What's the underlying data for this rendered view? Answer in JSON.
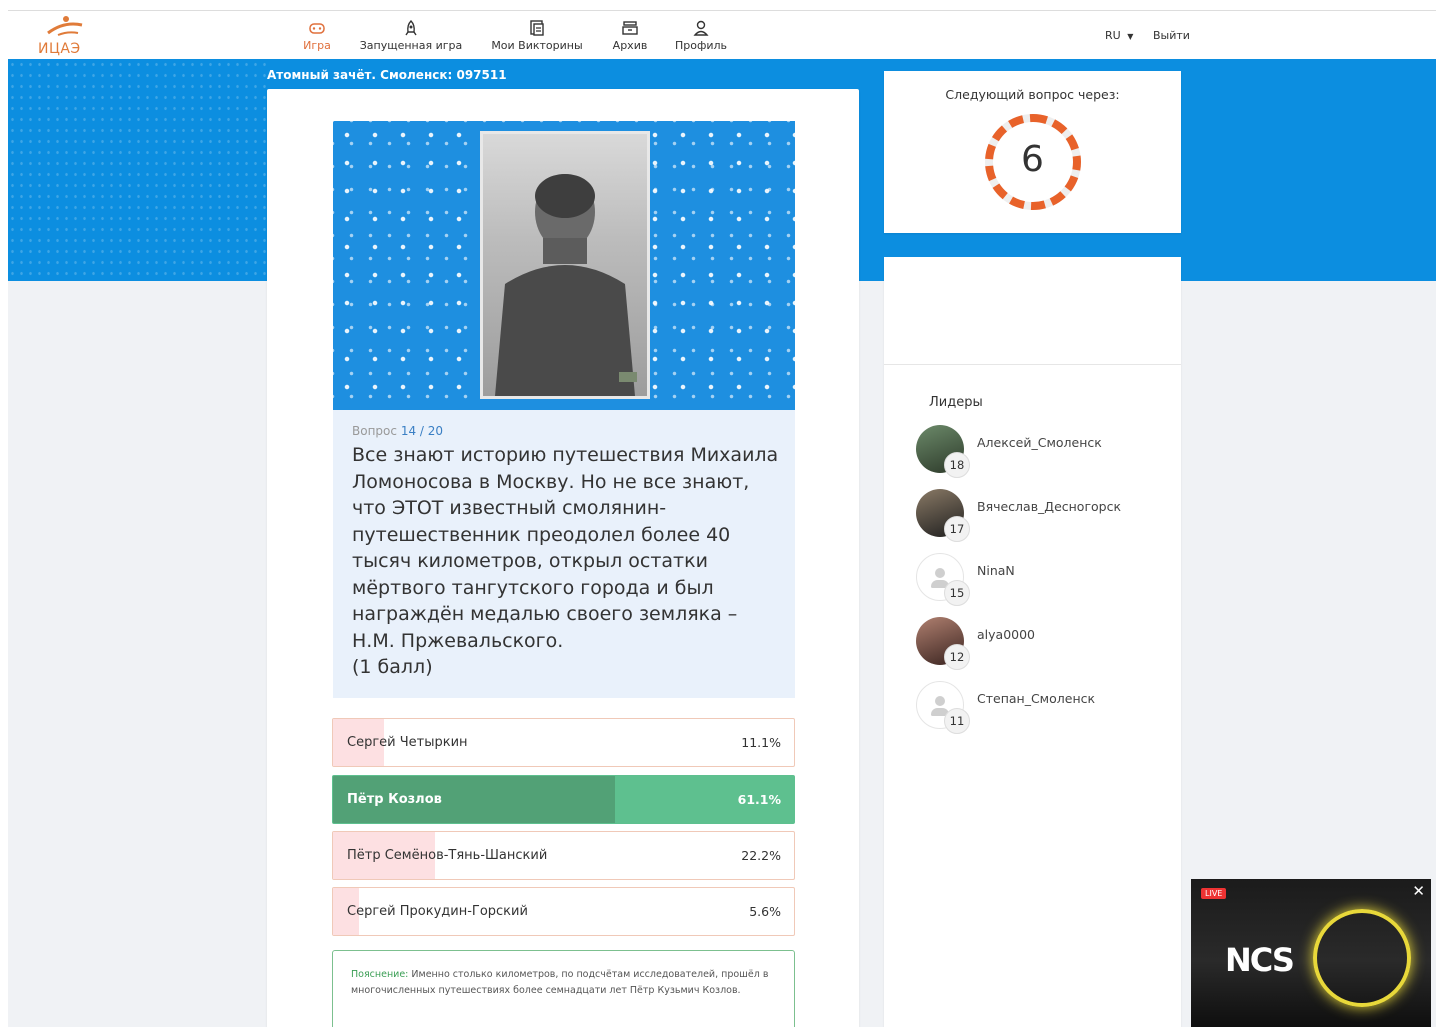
{
  "brand": {
    "logo_text": "ИЦАЭ"
  },
  "nav": {
    "items": [
      {
        "label": "Игра",
        "icon": "gamepad-icon",
        "active": true
      },
      {
        "label": "Запущенная игра",
        "icon": "rocket-icon",
        "active": false
      },
      {
        "label": "Мои Викторины",
        "icon": "documents-icon",
        "active": false
      },
      {
        "label": "Архив",
        "icon": "archive-icon",
        "active": false
      },
      {
        "label": "Профиль",
        "icon": "user-icon",
        "active": false
      }
    ],
    "lang": "RU",
    "logout": "Выйти"
  },
  "breadcrumb": "Атомный зачёт. Смоленск: 097511",
  "question": {
    "label": "Вопрос",
    "number": "14 / 20",
    "text": "Все знают историю путешествия Михаила Ломоносова в Москву. Но не все знают, что ЭТОТ известный смолянин-путешественник преодолел более 40 тысяч километров, открыл остатки мёртвого тангутского города и был награждён медалью своего земляка – Н.М. Пржевальского.",
    "points": "(1 балл)"
  },
  "answers": [
    {
      "label": "Сергей Четыркин",
      "percent": "11.1%",
      "share": 0.111,
      "correct": false
    },
    {
      "label": "Пётр Козлов",
      "percent": "61.1%",
      "share": 0.611,
      "correct": true
    },
    {
      "label": "Пётр Семёнов-Тянь-Шанский",
      "percent": "22.2%",
      "share": 0.222,
      "correct": false
    },
    {
      "label": "Сергей Прокудин-Горский",
      "percent": "5.6%",
      "share": 0.056,
      "correct": false
    }
  ],
  "explanation": {
    "label": "Пояснение:",
    "text": "Именно столько километров, по подсчётам исследователей, прошёл в многочисленных путешествиях более семнадцати лет Пётр Кузьмич Козлов."
  },
  "timer": {
    "title": "Следующий вопрос через:",
    "value": "6",
    "accent": "#e8622a"
  },
  "leaders": {
    "title": "Лидеры",
    "items": [
      {
        "name": "Алексей_Смоленск",
        "score": "18",
        "has_photo": true
      },
      {
        "name": "Вячеслав_Десногорск",
        "score": "17",
        "has_photo": true
      },
      {
        "name": "NinaN",
        "score": "15",
        "has_photo": false
      },
      {
        "name": "alya0000",
        "score": "12",
        "has_photo": true
      },
      {
        "name": "Степан_Смоленск",
        "score": "11",
        "has_photo": false
      }
    ]
  },
  "video": {
    "live": "LIVE",
    "close": "✕",
    "logo": "NCS"
  },
  "colors": {
    "banner": "#0c8ee0",
    "correct": "#5ec08f",
    "correct_dark": "#52a176",
    "wrong_fill": "#fde0e2",
    "nav_active": "#e0703c"
  }
}
